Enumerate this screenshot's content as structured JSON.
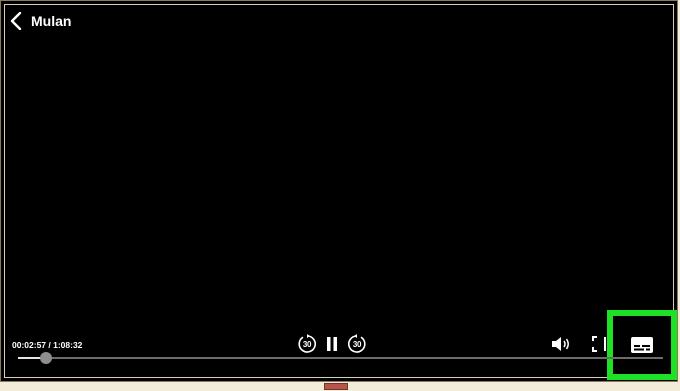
{
  "header": {
    "title": "Mulan",
    "back_icon": "chevron-left-icon"
  },
  "playback": {
    "time_readout": "00:02:57 / 1:08:32",
    "progress_fraction": 0.043,
    "rewind_label": "30",
    "forward_label": "30",
    "state": "playing"
  },
  "controls": {
    "rewind_icon": "replay-30-icon",
    "pause_icon": "pause-icon",
    "forward_icon": "forward-30-icon",
    "volume_icon": "volume-icon",
    "fullscreen_icon": "fullscreen-icon",
    "subtitles_icon": "subtitles-icon"
  },
  "colors": {
    "highlight": "#1ee025",
    "background": "#000000",
    "text": "#ffffff"
  }
}
